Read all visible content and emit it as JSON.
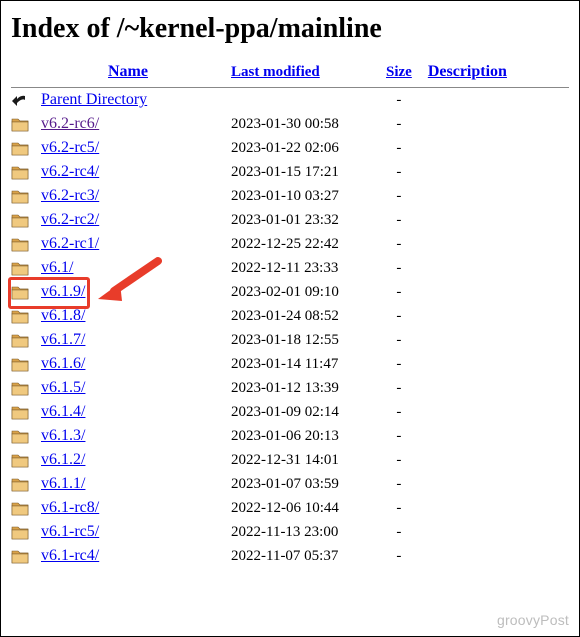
{
  "title": "Index of /~kernel-ppa/mainline",
  "headers": {
    "name": "Name",
    "modified": "Last modified",
    "size": "Size",
    "description": "Description"
  },
  "parent": {
    "label": "Parent Directory",
    "size": "-"
  },
  "rows": [
    {
      "name": "v6.2-rc6/",
      "modified": "2023-01-30 00:58",
      "size": "-",
      "visited": true
    },
    {
      "name": "v6.2-rc5/",
      "modified": "2023-01-22 02:06",
      "size": "-",
      "visited": false
    },
    {
      "name": "v6.2-rc4/",
      "modified": "2023-01-15 17:21",
      "size": "-",
      "visited": false
    },
    {
      "name": "v6.2-rc3/",
      "modified": "2023-01-10 03:27",
      "size": "-",
      "visited": false
    },
    {
      "name": "v6.2-rc2/",
      "modified": "2023-01-01 23:32",
      "size": "-",
      "visited": false
    },
    {
      "name": "v6.2-rc1/",
      "modified": "2022-12-25 22:42",
      "size": "-",
      "visited": false
    },
    {
      "name": "v6.1/",
      "modified": "2022-12-11 23:33",
      "size": "-",
      "visited": false
    },
    {
      "name": "v6.1.9/",
      "modified": "2023-02-01 09:10",
      "size": "-",
      "visited": false,
      "highlighted": true
    },
    {
      "name": "v6.1.8/",
      "modified": "2023-01-24 08:52",
      "size": "-",
      "visited": false
    },
    {
      "name": "v6.1.7/",
      "modified": "2023-01-18 12:55",
      "size": "-",
      "visited": false
    },
    {
      "name": "v6.1.6/",
      "modified": "2023-01-14 11:47",
      "size": "-",
      "visited": false
    },
    {
      "name": "v6.1.5/",
      "modified": "2023-01-12 13:39",
      "size": "-",
      "visited": false
    },
    {
      "name": "v6.1.4/",
      "modified": "2023-01-09 02:14",
      "size": "-",
      "visited": false
    },
    {
      "name": "v6.1.3/",
      "modified": "2023-01-06 20:13",
      "size": "-",
      "visited": false
    },
    {
      "name": "v6.1.2/",
      "modified": "2022-12-31 14:01",
      "size": "-",
      "visited": false
    },
    {
      "name": "v6.1.1/",
      "modified": "2023-01-07 03:59",
      "size": "-",
      "visited": false
    },
    {
      "name": "v6.1-rc8/",
      "modified": "2022-12-06 10:44",
      "size": "-",
      "visited": false
    },
    {
      "name": "v6.1-rc5/",
      "modified": "2022-11-13 23:00",
      "size": "-",
      "visited": false
    },
    {
      "name": "v6.1-rc4/",
      "modified": "2022-11-07 05:37",
      "size": "-",
      "visited": false
    }
  ],
  "annotation": {
    "highlight_color": "#e83c2a",
    "arrow_color": "#e83c2a"
  },
  "watermark": "groovyPost"
}
